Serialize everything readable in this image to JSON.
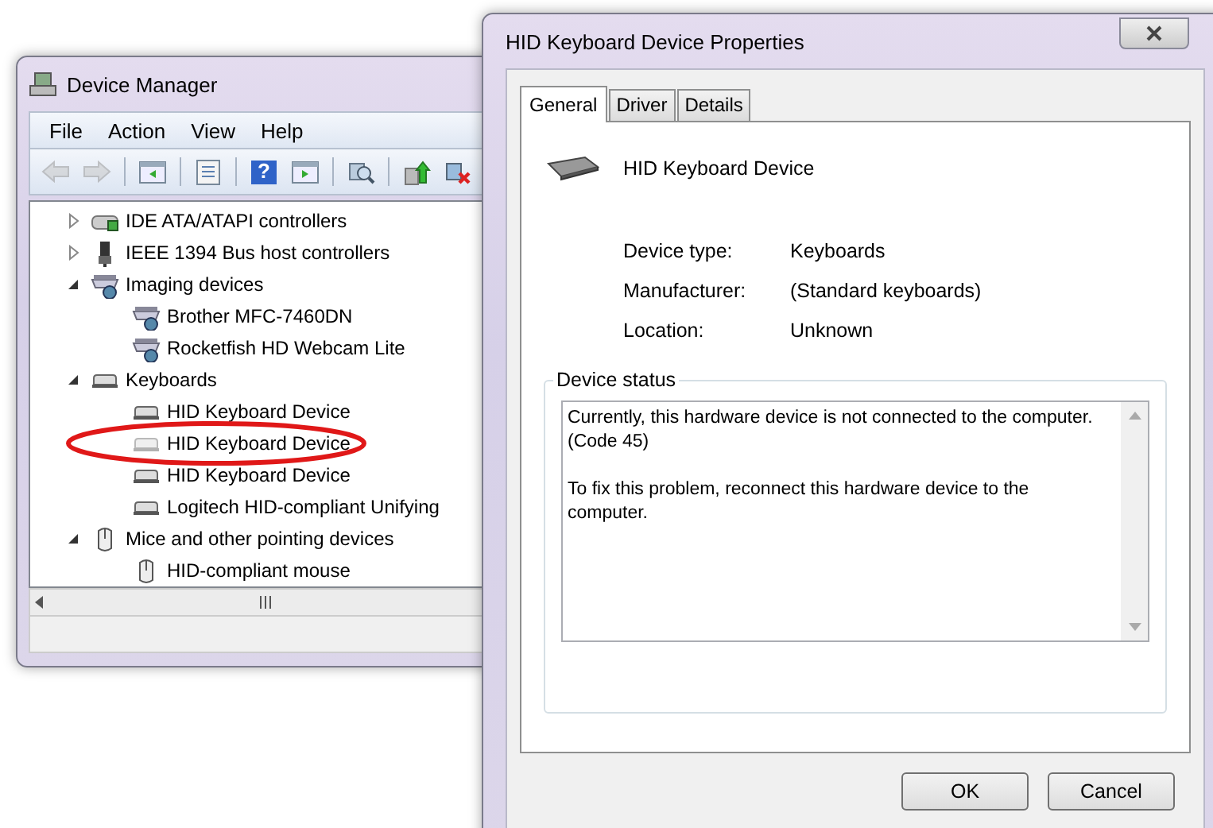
{
  "device_manager": {
    "title": "Device Manager",
    "menu": [
      "File",
      "Action",
      "View",
      "Help"
    ],
    "toolbar": [
      {
        "kind": "back",
        "disabled": true
      },
      {
        "kind": "forward",
        "disabled": true
      },
      {
        "kind": "panel-left",
        "disabled": false
      },
      {
        "kind": "sheet",
        "disabled": false
      },
      {
        "kind": "help",
        "disabled": false,
        "glyph": "?"
      },
      {
        "kind": "panel-right",
        "disabled": false
      },
      {
        "kind": "scan",
        "disabled": false
      },
      {
        "kind": "update",
        "disabled": false
      },
      {
        "kind": "remove",
        "disabled": false
      }
    ],
    "tree": [
      {
        "label": "IDE ATA/ATAPI controllers",
        "kind": "ide",
        "expanded": false,
        "ghost": false
      },
      {
        "label": "IEEE 1394 Bus host controllers",
        "kind": "ieee",
        "expanded": false,
        "ghost": false
      },
      {
        "label": "Imaging devices",
        "kind": "imaging",
        "expanded": true,
        "ghost": false,
        "children": [
          {
            "label": "Brother MFC-7460DN",
            "kind": "imaging",
            "ghost": false
          },
          {
            "label": "Rocketfish HD Webcam Lite",
            "kind": "imaging",
            "ghost": false
          }
        ]
      },
      {
        "label": "Keyboards",
        "kind": "keyboard",
        "expanded": true,
        "ghost": false,
        "children": [
          {
            "label": "HID Keyboard Device",
            "kind": "keyboard",
            "ghost": false
          },
          {
            "label": "HID Keyboard Device",
            "kind": "keyboard",
            "ghost": true,
            "circled": true
          },
          {
            "label": "HID Keyboard Device",
            "kind": "keyboard",
            "ghost": false
          },
          {
            "label": "Logitech HID-compliant Unifying",
            "kind": "keyboard",
            "ghost": false
          }
        ]
      },
      {
        "label": "Mice and other pointing devices",
        "kind": "mouse",
        "expanded": true,
        "ghost": false,
        "children": [
          {
            "label": "HID-compliant mouse",
            "kind": "mouse",
            "ghost": false
          }
        ]
      }
    ]
  },
  "properties": {
    "title": "HID Keyboard Device Properties",
    "tabs": [
      {
        "label": "General",
        "selected": true
      },
      {
        "label": "Driver",
        "selected": false
      },
      {
        "label": "Details",
        "selected": false
      }
    ],
    "device_name": "HID Keyboard Device",
    "info": [
      {
        "label": "Device type:",
        "value": "Keyboards"
      },
      {
        "label": "Manufacturer:",
        "value": "(Standard keyboards)"
      },
      {
        "label": "Location:",
        "value": "Unknown"
      }
    ],
    "status_group": "Device status",
    "status_paragraphs": [
      [
        "Currently, this hardware device is not connected to the computer.",
        "(Code 45)"
      ],
      [
        "To fix this problem, reconnect this hardware device to the",
        "computer."
      ]
    ],
    "buttons": [
      "OK",
      "Cancel"
    ]
  }
}
